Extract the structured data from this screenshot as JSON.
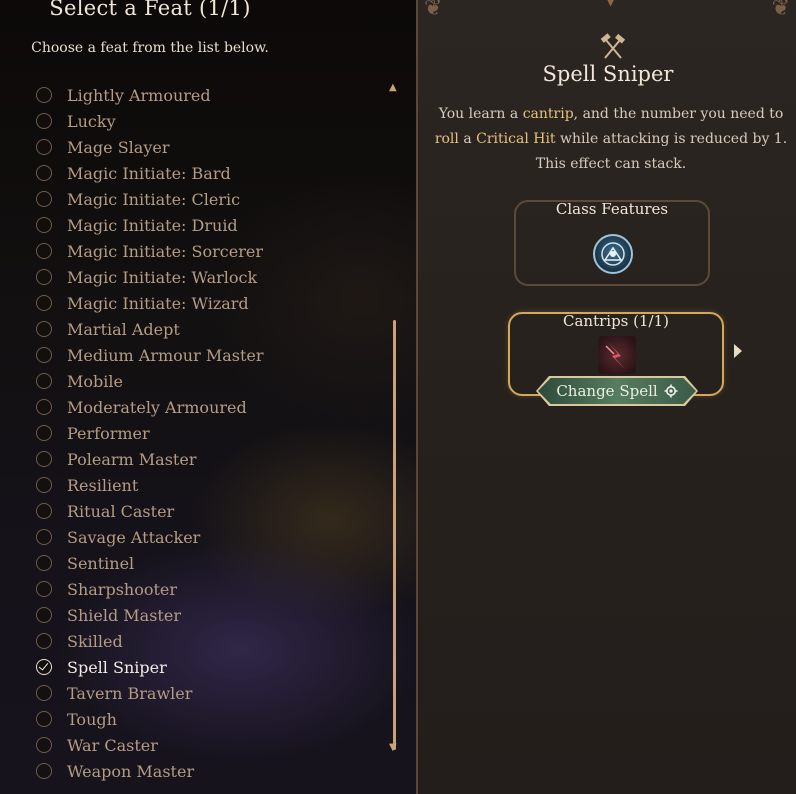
{
  "left_panel": {
    "title": "Select a Feat (1/1)",
    "subtitle": "Choose a feat from the list below.",
    "feats": [
      {
        "label": "Lightly Armoured",
        "selected": false
      },
      {
        "label": "Lucky",
        "selected": false
      },
      {
        "label": "Mage Slayer",
        "selected": false
      },
      {
        "label": "Magic Initiate: Bard",
        "selected": false
      },
      {
        "label": "Magic Initiate: Cleric",
        "selected": false
      },
      {
        "label": "Magic Initiate: Druid",
        "selected": false
      },
      {
        "label": "Magic Initiate: Sorcerer",
        "selected": false
      },
      {
        "label": "Magic Initiate: Warlock",
        "selected": false
      },
      {
        "label": "Magic Initiate: Wizard",
        "selected": false
      },
      {
        "label": "Martial Adept",
        "selected": false
      },
      {
        "label": "Medium Armour Master",
        "selected": false
      },
      {
        "label": "Mobile",
        "selected": false
      },
      {
        "label": "Moderately Armoured",
        "selected": false
      },
      {
        "label": "Performer",
        "selected": false
      },
      {
        "label": "Polearm Master",
        "selected": false
      },
      {
        "label": "Resilient",
        "selected": false
      },
      {
        "label": "Ritual Caster",
        "selected": false
      },
      {
        "label": "Savage Attacker",
        "selected": false
      },
      {
        "label": "Sentinel",
        "selected": false
      },
      {
        "label": "Sharpshooter",
        "selected": false
      },
      {
        "label": "Shield Master",
        "selected": false
      },
      {
        "label": "Skilled",
        "selected": false
      },
      {
        "label": "Spell Sniper",
        "selected": true
      },
      {
        "label": "Tavern Brawler",
        "selected": false
      },
      {
        "label": "Tough",
        "selected": false
      },
      {
        "label": "War Caster",
        "selected": false
      },
      {
        "label": "Weapon Master",
        "selected": false
      }
    ]
  },
  "detail": {
    "title": "Spell Sniper",
    "desc_parts": [
      {
        "text": "You learn a ",
        "hl": false
      },
      {
        "text": "cantrip",
        "hl": true
      },
      {
        "text": ", and the number you need to ",
        "hl": false
      },
      {
        "text": "roll",
        "hl": true
      },
      {
        "text": " a ",
        "hl": false
      },
      {
        "text": "Critical Hit",
        "hl": true
      },
      {
        "text": " while attacking is reduced by 1. This effect can stack.",
        "hl": false
      }
    ],
    "class_features_label": "Class Features",
    "cantrips_label": "Cantrips (1/1)",
    "change_spell_label": "Change Spell"
  },
  "colors": {
    "highlight": "#e5c27d",
    "selected_border": "#d4a857",
    "unselected_text": "#b59c84"
  }
}
